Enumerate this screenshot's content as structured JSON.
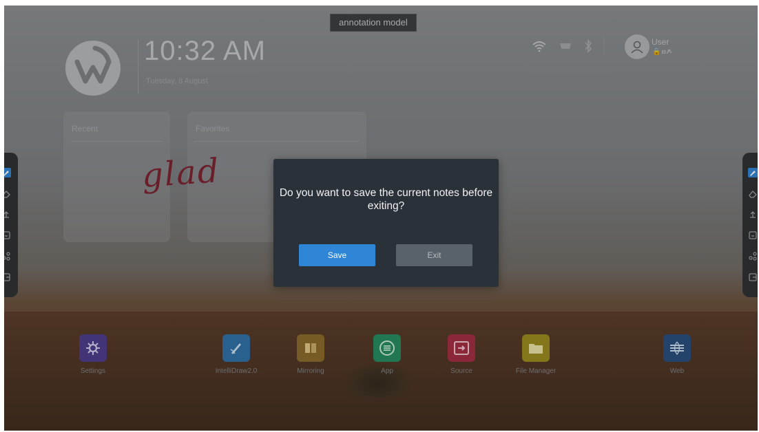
{
  "top_bar": {
    "mode_label": "annotation model"
  },
  "clock": {
    "time": "10:32 AM",
    "date": "Tuesday, 8 August"
  },
  "status": {
    "user_name": "User",
    "user_icons_text": "🔒⊟ዶ"
  },
  "cards": [
    {
      "title": "Recent"
    },
    {
      "title": "Favorites"
    }
  ],
  "annotation": {
    "handwriting": "glad"
  },
  "dialog": {
    "message": "Do you want to save the current notes before exiting?",
    "save_label": "Save",
    "exit_label": "Exit"
  },
  "dock": {
    "apps": [
      {
        "label": "Settings",
        "icon": "settings-icon",
        "color": "#4b3a8c"
      },
      {
        "label": "IntelliDraw2.0",
        "icon": "pen-icon",
        "color": "#2d6fa8"
      },
      {
        "label": "Mirroring",
        "icon": "mirror-icon",
        "color": "#8a6a2a"
      },
      {
        "label": "App",
        "icon": "apps-icon",
        "color": "#238c5e"
      },
      {
        "label": "Source",
        "icon": "source-icon",
        "color": "#a32a40"
      },
      {
        "label": "File Manager",
        "icon": "folder-icon",
        "color": "#9a8a1c"
      },
      {
        "label": "Web",
        "icon": "web-icon",
        "color": "#264c7c"
      }
    ]
  },
  "colors": {
    "accent": "#2f86d6",
    "dialog_bg": "#2b3138",
    "annotation_ink": "#7a1f2e",
    "toolbar_bg": "#2d2e30"
  }
}
